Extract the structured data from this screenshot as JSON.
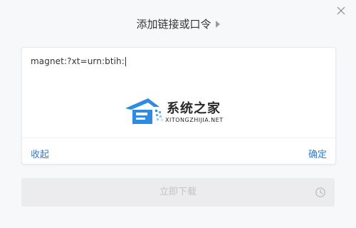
{
  "dialog": {
    "title": "添加链接或口令",
    "link_value": "magnet:?xt=urn:btih:",
    "collapse_label": "收起",
    "confirm_label": "确定",
    "download_label": "立即下载"
  },
  "watermark": {
    "name": "系统之家",
    "domain": "XITONGZHIJIA.NET"
  },
  "icons": {
    "close": "close-icon",
    "title_arrow": "triangle-right-icon",
    "download_schedule": "clock-icon"
  },
  "colors": {
    "link": "#2f7bd8",
    "disabled_text": "#c3c3c6",
    "disabled_bg": "#ececee"
  }
}
